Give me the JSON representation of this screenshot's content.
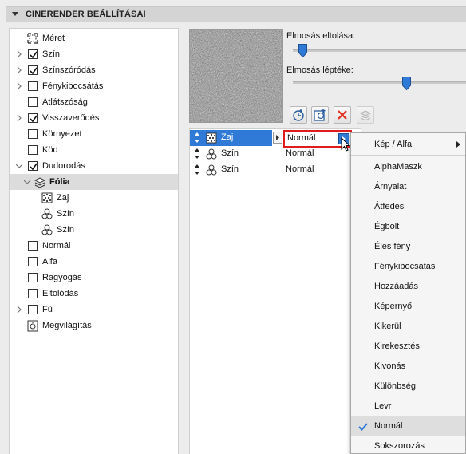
{
  "header": {
    "title": "CINERENDER BEÁLLÍTÁSAI"
  },
  "tree": {
    "items": [
      {
        "label": "Méret",
        "checkbox": null,
        "icon": "size-icon",
        "expand": false
      },
      {
        "label": "Szín",
        "checkbox": true,
        "expand": true
      },
      {
        "label": "Színszóródás",
        "checkbox": true,
        "expand": true
      },
      {
        "label": "Fénykibocsátás",
        "checkbox": false,
        "expand": true
      },
      {
        "label": "Átlátszóság",
        "checkbox": false,
        "expand": false
      },
      {
        "label": "Visszaverődés",
        "checkbox": true,
        "expand": true
      },
      {
        "label": "Környezet",
        "checkbox": false,
        "expand": false
      },
      {
        "label": "Köd",
        "checkbox": false,
        "expand": false
      },
      {
        "label": "Dudorodás",
        "checkbox": true,
        "expand": "open"
      },
      {
        "label": "Fólia",
        "icon": "layers-icon",
        "expand": "open",
        "selected": true
      },
      {
        "label": "Zaj",
        "icon": "noise-icon"
      },
      {
        "label": "Szín",
        "icon": "color-circles-icon"
      },
      {
        "label": "Szín",
        "icon": "color-circles-icon"
      },
      {
        "label": "Normál",
        "checkbox": false,
        "expand": false
      },
      {
        "label": "Alfa",
        "checkbox": false,
        "expand": false
      },
      {
        "label": "Ragyogás",
        "checkbox": false,
        "expand": false
      },
      {
        "label": "Eltolódás",
        "checkbox": false,
        "expand": false
      },
      {
        "label": "Fű",
        "checkbox": false,
        "expand": true
      },
      {
        "label": "Megvilágítás",
        "icon": "lighting-icon",
        "expand": false
      }
    ]
  },
  "sliders": {
    "blur_offset": {
      "label": "Elmosás eltolása:",
      "value": 0.03
    },
    "blur_scale": {
      "label": "Elmosás léptéke:",
      "value": 0.63
    }
  },
  "toolbar": {
    "icons": [
      "add-shader-icon",
      "add-layer-icon",
      "delete-icon",
      "copy-icon"
    ]
  },
  "layers": [
    {
      "name": "Zaj",
      "icon": "noise-icon",
      "blend": "Normál",
      "active": true
    },
    {
      "name": "Szín",
      "icon": "color-circles-icon",
      "blend": "Normál",
      "active": false
    },
    {
      "name": "Szín",
      "icon": "color-circles-icon",
      "blend": "Normál",
      "active": false
    }
  ],
  "menu": {
    "top": "Kép / Alfa",
    "items": [
      "AlphaMaszk",
      "Árnyalat",
      "Átfedés",
      "Égbolt",
      "Éles fény",
      "Fénykibocsátás",
      "Hozzáadás",
      "Képernyő",
      "Kikerül",
      "Kirekesztés",
      "Kivonás",
      "Különbség",
      "Levr",
      "Normál",
      "Sokszorozás"
    ],
    "checked": "Normál"
  },
  "colors": {
    "accent": "#2f7ad6",
    "highlight_border": "#e01b1b",
    "delete": "#e0301e"
  }
}
